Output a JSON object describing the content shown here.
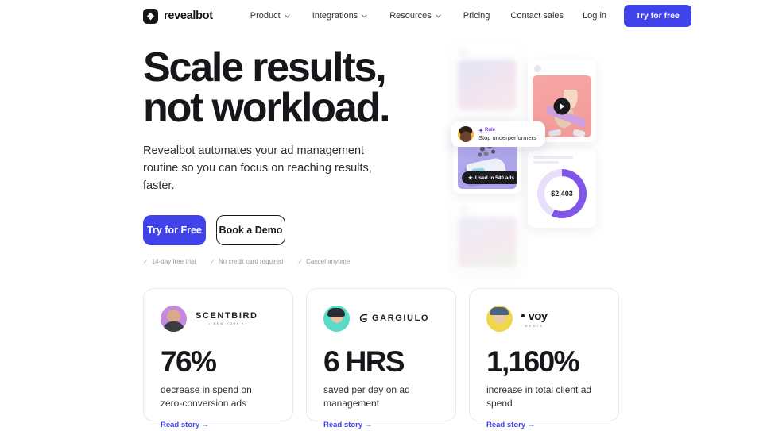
{
  "nav": {
    "brand": "revealbot",
    "brand_icon": "revealbot-diamond-logo",
    "links": [
      {
        "label": "Product",
        "has_chevron": true
      },
      {
        "label": "Integrations",
        "has_chevron": true
      },
      {
        "label": "Resources",
        "has_chevron": true
      },
      {
        "label": "Pricing",
        "has_chevron": false
      }
    ],
    "contact_sales": "Contact sales",
    "log_in": "Log in",
    "try_free": "Try for free"
  },
  "hero": {
    "heading_line1": "Scale results,",
    "heading_line2": "not workload.",
    "subheading": "Revealbot automates your ad management routine so you can focus on reaching results, faster.",
    "primary_cta": "Try for Free",
    "secondary_cta": "Book a Demo",
    "trust": [
      {
        "tick": "✓",
        "label": "14-day free trial"
      },
      {
        "tick": "✓",
        "label": "No credit card required"
      },
      {
        "tick": "✓",
        "label": "Cancel anytime"
      }
    ]
  },
  "art": {
    "rule_badge": {
      "label": "Rule",
      "icon": "sparkle-icon",
      "text": "Stop underperformers"
    },
    "ads_badge": {
      "icon": "star-icon",
      "text": "Used in 540 ads"
    },
    "video_card": {
      "play_icon": "play-icon"
    },
    "donut": {
      "value": "$2,403",
      "percent": 57,
      "arc_color": "#7f56e8",
      "track_color": "#e7dffb"
    }
  },
  "cards": [
    {
      "avatar": "avatar-scentbird",
      "logo_main": "SCENTBIRD",
      "logo_sub": "• NEW YORK •",
      "logo_type": "text",
      "value": "76%",
      "description": "decrease in spend on zero-conversion ads",
      "link": "Read story →"
    },
    {
      "avatar": "avatar-gargiulo",
      "logo_main": "GARGIULO",
      "logo_sub": "",
      "logo_type": "mark",
      "value": "6 HRS",
      "description": "saved per day on ad management",
      "link": "Read story →"
    },
    {
      "avatar": "avatar-voy",
      "logo_main": "voy",
      "logo_sub": "MEDIA",
      "logo_type": "voy",
      "value": "1,160%",
      "description": "increase in total client ad spend",
      "link": "Read story →"
    }
  ],
  "colors": {
    "accent_blue": "#4043ea",
    "accent_purple": "#7f56e8",
    "text_dark": "#17171b"
  }
}
